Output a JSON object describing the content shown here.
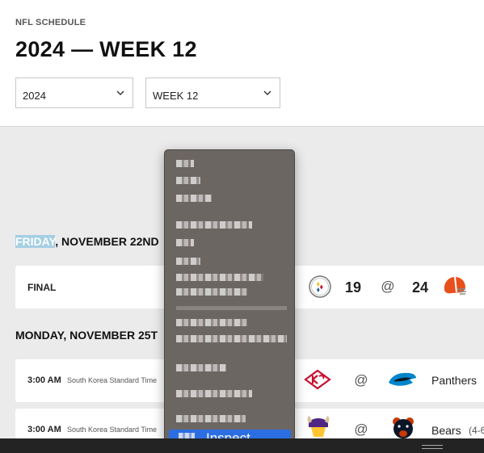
{
  "header": {
    "eyebrow": "NFL SCHEDULE",
    "title": "2024 — WEEK 12",
    "season_select": {
      "value": "2024"
    },
    "week_select": {
      "value": "WEEK 12"
    }
  },
  "sections": [
    {
      "day_highlight": "FRIDAY",
      "day_rest": ", NOVEMBER 22ND",
      "games": [
        {
          "status": "FINAL",
          "away_team": "Steelers",
          "away_score": "19",
          "at": "@",
          "home_team": "Browns",
          "home_score": "24"
        }
      ]
    },
    {
      "day": "MONDAY, NOVEMBER 25T",
      "games": [
        {
          "time": "3:00 AM",
          "timezone": "South Korea Standard Time",
          "away_team": "Chiefs",
          "at": "@",
          "home_team": "Panthers",
          "home_label": "Panthers"
        },
        {
          "time": "3:00 AM",
          "timezone": "South Korea Standard Time",
          "away_team": "Vikings",
          "at": "@",
          "home_team": "Bears",
          "home_label": "Bears",
          "home_record": "(4-6"
        }
      ]
    }
  ],
  "context_menu": {
    "inspect_label": "Inspect"
  },
  "colors": {
    "highlight": "#a5cfe3",
    "menu_bg": "#6c6663",
    "inspect_bg": "#2b6ee2"
  }
}
